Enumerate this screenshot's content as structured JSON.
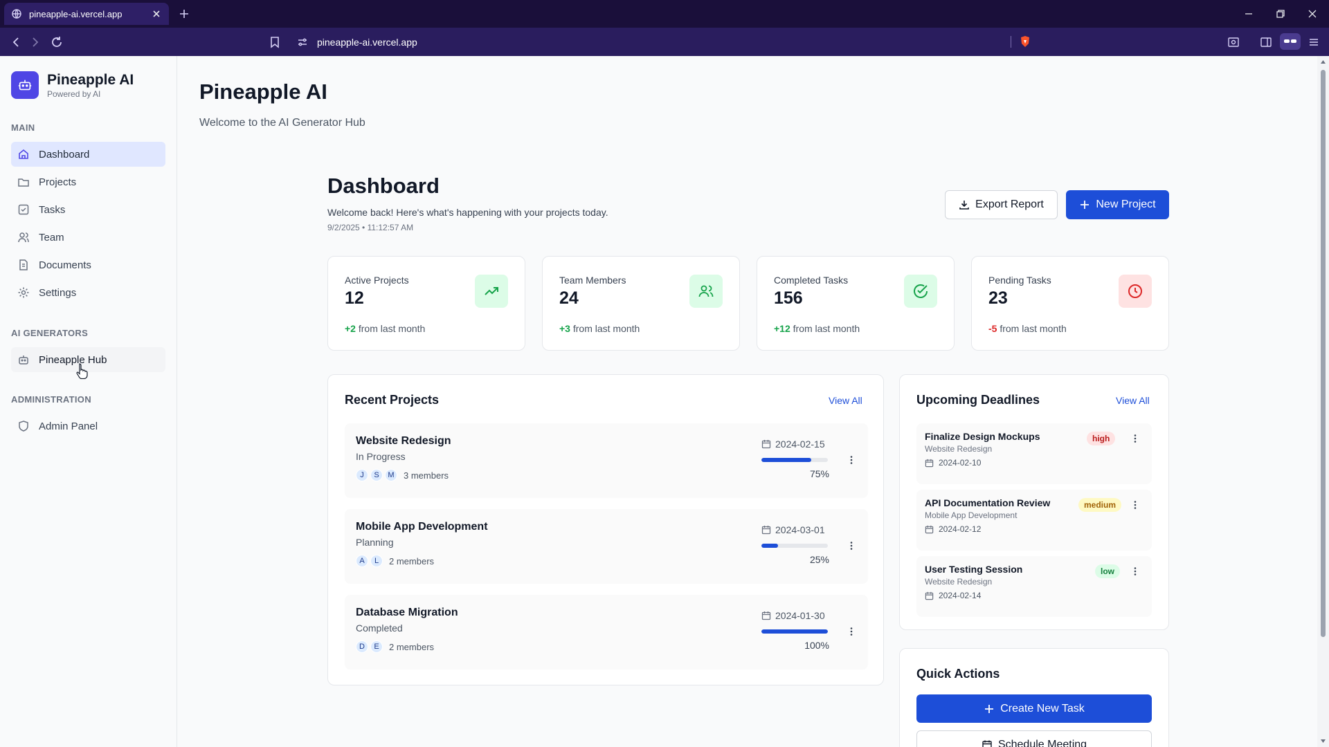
{
  "browser": {
    "tab_title": "pineapple-ai.vercel.app",
    "url": "pineapple-ai.vercel.app"
  },
  "sidebar": {
    "brand_name": "Pineapple AI",
    "brand_sub": "Powered by AI",
    "sections": [
      {
        "label": "MAIN",
        "items": [
          {
            "label": "Dashboard",
            "icon": "home-icon",
            "active": true
          },
          {
            "label": "Projects",
            "icon": "folder-icon"
          },
          {
            "label": "Tasks",
            "icon": "check-square-icon"
          },
          {
            "label": "Team",
            "icon": "users-icon"
          },
          {
            "label": "Documents",
            "icon": "file-icon"
          },
          {
            "label": "Settings",
            "icon": "gear-icon"
          }
        ]
      },
      {
        "label": "AI GENERATORS",
        "items": [
          {
            "label": "Pineapple Hub",
            "icon": "bot-icon",
            "hover": true
          }
        ]
      },
      {
        "label": "ADMINISTRATION",
        "items": [
          {
            "label": "Admin Panel",
            "icon": "shield-icon"
          }
        ]
      }
    ]
  },
  "header": {
    "title": "Pineapple AI",
    "subtitle": "Welcome to the AI Generator Hub"
  },
  "dashboard": {
    "title": "Dashboard",
    "subtitle": "Welcome back! Here's what's happening with your projects today.",
    "timestamp": "9/2/2025 • 11:12:57 AM",
    "export_label": "Export Report",
    "new_project_label": "New Project"
  },
  "stats": [
    {
      "label": "Active Projects",
      "value": "12",
      "change": "+2",
      "change_suffix": " from last month",
      "icon": "trending-up-icon",
      "accent": "#16a34a",
      "accent_bg": "#dcfce7"
    },
    {
      "label": "Team Members",
      "value": "24",
      "change": "+3",
      "change_suffix": " from last month",
      "icon": "users-icon",
      "accent": "#16a34a",
      "accent_bg": "#dcfce7"
    },
    {
      "label": "Completed Tasks",
      "value": "156",
      "change": "+12",
      "change_suffix": " from last month",
      "icon": "check-circle-icon",
      "accent": "#16a34a",
      "accent_bg": "#dcfce7"
    },
    {
      "label": "Pending Tasks",
      "value": "23",
      "change": "-5",
      "change_suffix": " from last month",
      "icon": "clock-icon",
      "accent": "#dc2626",
      "accent_bg": "#fee2e2"
    }
  ],
  "recent_projects": {
    "title": "Recent Projects",
    "view_all": "View All",
    "items": [
      {
        "name": "Website Redesign",
        "status": "In Progress",
        "avatars": [
          "J",
          "S",
          "M"
        ],
        "members": "3 members",
        "date": "2024-02-15",
        "progress": 75,
        "progress_label": "75%"
      },
      {
        "name": "Mobile App Development",
        "status": "Planning",
        "avatars": [
          "A",
          "L"
        ],
        "members": "2 members",
        "date": "2024-03-01",
        "progress": 25,
        "progress_label": "25%"
      },
      {
        "name": "Database Migration",
        "status": "Completed",
        "avatars": [
          "D",
          "E"
        ],
        "members": "2 members",
        "date": "2024-01-30",
        "progress": 100,
        "progress_label": "100%"
      }
    ]
  },
  "deadlines": {
    "title": "Upcoming Deadlines",
    "view_all": "View All",
    "items": [
      {
        "name": "Finalize Design Mockups",
        "project": "Website Redesign",
        "date": "2024-02-10",
        "priority": "high",
        "badge_color": "#b91c1c",
        "badge_bg": "#fee2e2"
      },
      {
        "name": "API Documentation Review",
        "project": "Mobile App Development",
        "date": "2024-02-12",
        "priority": "medium",
        "badge_color": "#a16207",
        "badge_bg": "#fef9c3"
      },
      {
        "name": "User Testing Session",
        "project": "Website Redesign",
        "date": "2024-02-14",
        "priority": "low",
        "badge_color": "#15803d",
        "badge_bg": "#dcfce7"
      }
    ]
  },
  "quick_actions": {
    "title": "Quick Actions",
    "create_task": "Create New Task",
    "schedule_meeting": "Schedule Meeting"
  },
  "colors": {
    "primary": "#1d4ed8",
    "brand": "#4f46e5",
    "sidebar_active_bg": "#e0e7ff",
    "browser_frame": "#1a0f3a"
  }
}
